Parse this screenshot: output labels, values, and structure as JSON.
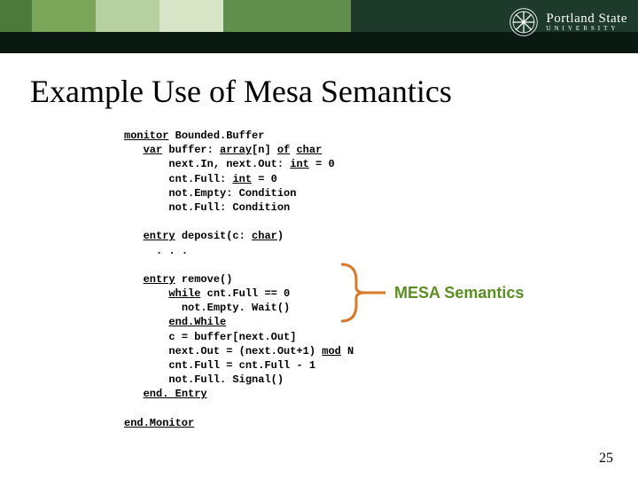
{
  "banner": {
    "university_line1": "Portland State",
    "university_line2": "UNIVERSITY",
    "icon": "snowflake-seal-icon"
  },
  "title": "Example Use of Mesa Semantics",
  "code": {
    "l01a": "monitor",
    "l01b": " Bounded.Buffer",
    "l02a": "var",
    "l02b": " buffer: ",
    "l02c": "array",
    "l02d": "[n] ",
    "l02e": "of",
    "l02f": " ",
    "l02g": "char",
    "l03a": "next.In, next.Out: ",
    "l03b": "int",
    "l03c": " = 0",
    "l04a": "cnt.Full: ",
    "l04b": "int",
    "l04c": " = 0",
    "l05": "not.Empty: Condition",
    "l06": "not.Full: Condition",
    "l07a": "entry",
    "l07b": " deposit(c: ",
    "l07c": "char",
    "l07d": ")",
    "l08": ". . .",
    "l09a": "entry",
    "l09b": " remove()",
    "l10a": "while",
    "l10b": " cnt.Full == 0",
    "l11": "not.Empty. Wait()",
    "l12": "end.While",
    "l13": "c = buffer[next.Out]",
    "l14a": "next.Out = (next.Out+1) ",
    "l14b": "mod",
    "l14c": " N",
    "l15": "cnt.Full = cnt.Full - 1",
    "l16": "not.Full. Signal()",
    "l17": "end. Entry",
    "l18": "end.Monitor"
  },
  "callout": "MESA Semantics",
  "page_number": "25"
}
